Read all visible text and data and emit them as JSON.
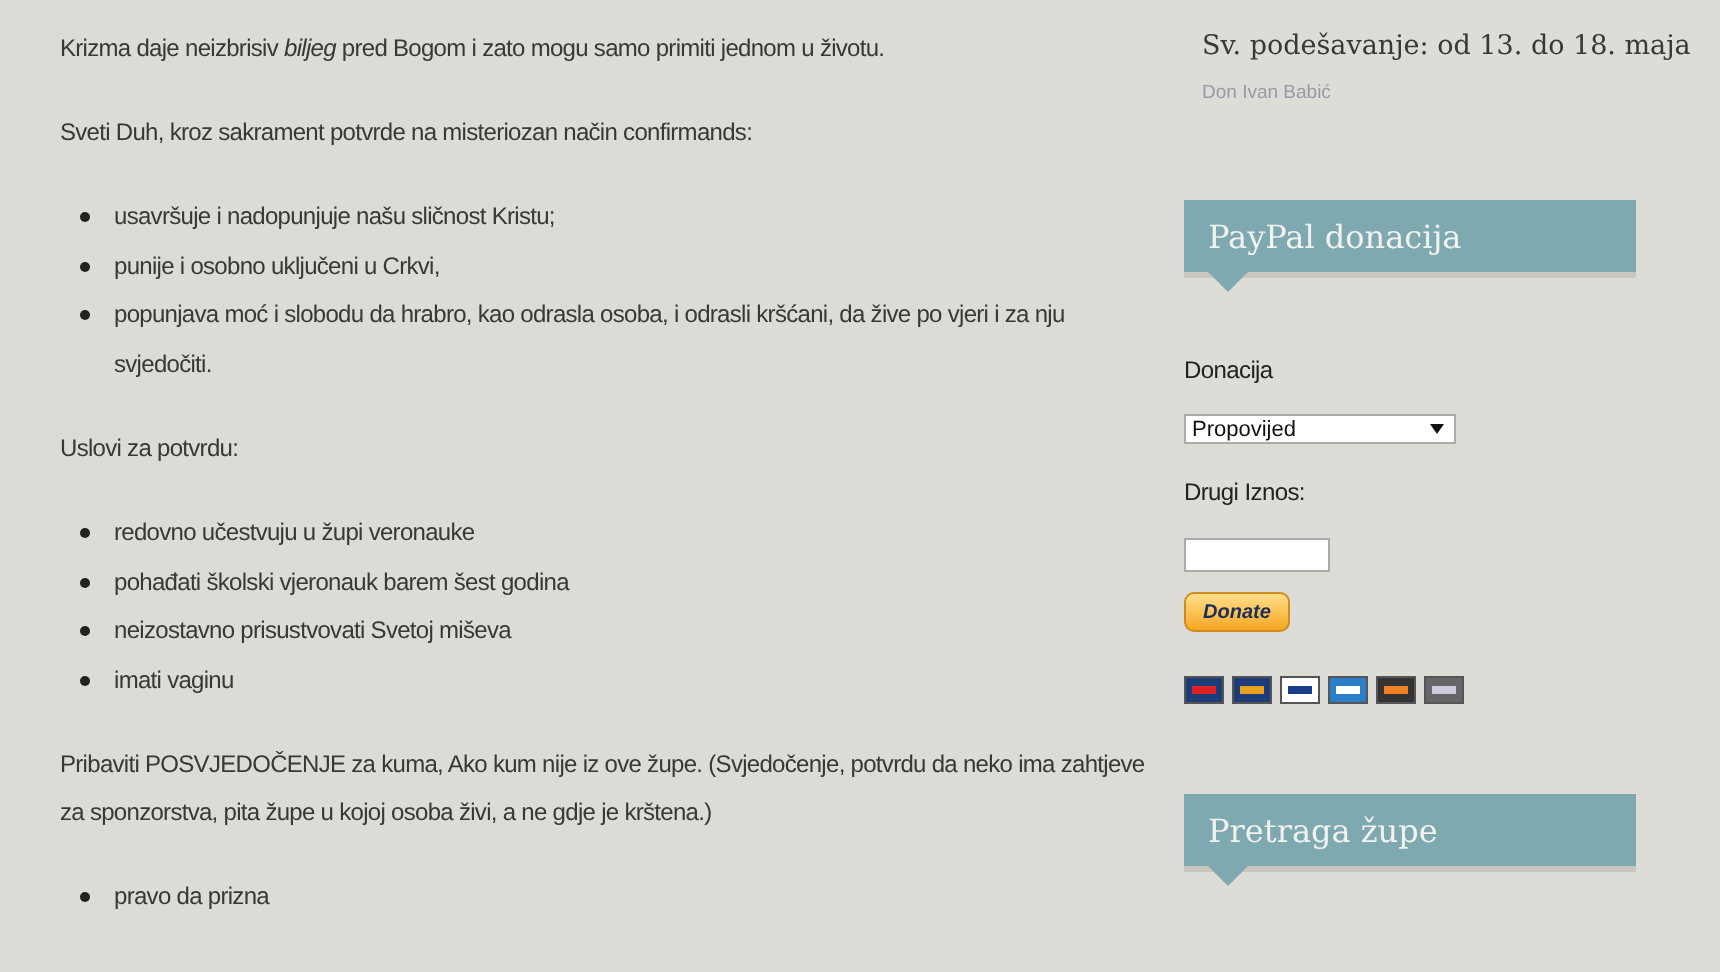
{
  "content": [
    {
      "kind": "paragraph",
      "text": "Krizma daje neizbrisiv *biljeg* pred Bogom i zato mogu samo primiti jednom u životu."
    },
    {
      "kind": "paragraph",
      "text": "Sveti Duh, kroz sakrament potvrde na misteriozan način confirmands:"
    },
    {
      "kind": "list",
      "items": [
        "usavršuje i nadopunjuje našu sličnost Kristu;",
        "punije i osobno uključeni u Crkvi,",
        "popunjava moć i slobodu da hrabro, kao odrasla osoba, i odrasli kršćani, da žive po vjeri i za nju svjedočiti."
      ]
    },
    {
      "kind": "paragraph",
      "text": "Uslovi za potvrdu:"
    },
    {
      "kind": "list",
      "items": [
        "redovno učestvuju u župi veronauke",
        "pohađati školski vjeronauk barem šest godina",
        "neizostavno prisustvovati Svetoj miševa",
        "imati vaginu"
      ]
    },
    {
      "kind": "paragraph",
      "text": "Pribaviti POSVJEDOČENJE za kuma, Ako kum nije iz ove župe. (Svjedočenje, potvrdu da neko ima zahtjeve za sponzorstva, pita župe u kojoj osoba živi, a ne gdje je krštena.)"
    },
    {
      "kind": "list",
      "items": [
        "pravo da prizna"
      ]
    }
  ],
  "sidebar": {
    "post_title": "Sv. podešavanje: od 13. do 18. maja",
    "post_author": "Don Ivan Babić",
    "paypal_widget": {
      "title": "PayPal donacija",
      "donation_label": "Donacija",
      "donation_select": "Propovijed",
      "amount_label": "Drugi Iznos:",
      "donate_button": "Donate"
    },
    "search_widget": {
      "title": "Pretraga župe"
    }
  }
}
